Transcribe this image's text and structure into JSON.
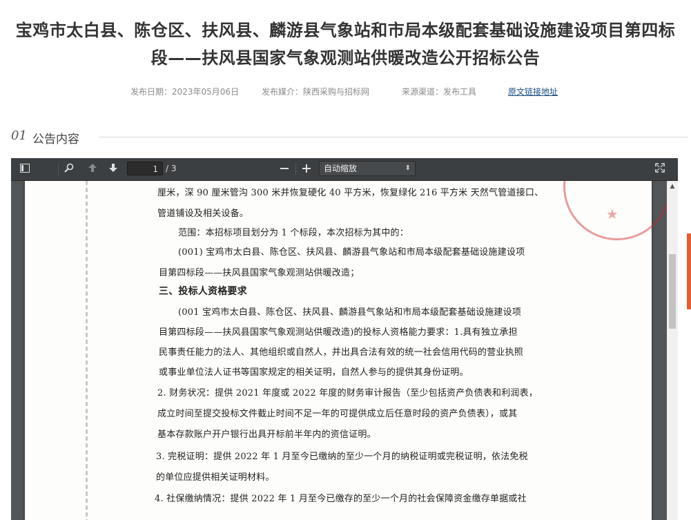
{
  "article": {
    "title_line1": "宝鸡市太白县、陈仓区、扶风县、麟游县气象站和市局本级配套基础设施建设项目第四标",
    "title_line2": "段——扶风县国家气象观测站供暖改造公开招标公告",
    "publish_date": "发布日期：2023年05月06日",
    "publish_media": "发布媒介：陕西采购与招标网",
    "source_channel": "来源渠道：发布工具",
    "original_link": "原文链接地址"
  },
  "section": {
    "number": "01",
    "label": "公告内容"
  },
  "pdf_viewer": {
    "current_page": "1",
    "total_pages": "/ 3",
    "zoom": "自动缩放",
    "icons": {
      "sidebar": "sidebar-toggle-icon",
      "search": "search-icon",
      "prev": "arrow-up-icon",
      "next": "arrow-down-icon",
      "zoom_out": "minus-icon",
      "zoom_in": "plus-icon",
      "fullscreen": "fullscreen-icon"
    }
  },
  "document_lines": [
    "厘米，深 90 厘米管沟 300 米并恢复硬化 40 平方米，恢复绿化 216 平方米 天然气管道接口、",
    "管道铺设及相关设备。",
    "范围：本招标项目划分为 1 个标段，本次招标为其中的：",
    "(001) 宝鸡市太白县、陈仓区、扶风县、麟游县气象站和市局本级配套基础设施建设项",
    "目第四标段——扶风县国家气象观测站供暖改造；",
    "三、投标人资格要求",
    "(001 宝鸡市太白县、陈仓区、扶风县、麟游县气象站和市局本级配套基础设施建设项",
    "目第四标段——扶风县国家气象观测站供暖改造)的投标人资格能力要求：1.具有独立承担",
    "民事责任能力的法人、其他组织或自然人，并出具合法有效的统一社会信用代码的营业执照",
    "或事业单位法人证书等国家规定的相关证明，自然人参与的提供其身份证明。",
    "2. 财务状况：提供 2021 年度或 2022 年度的财务审计报告（至少包括资产负债表和利润表，",
    "成立时间至提交投标文件截止时间不足一年的可提供成立后任意时段的资产负债表），或其",
    "基本存款账户开户银行出具开标前半年内的资信证明。",
    "3. 完税证明：提供 2022 年 1 月至今已缴纳的至少一个月的纳税证明或完税证明，依法免税",
    "的单位应提供相关证明材料。",
    "4. 社保缴纳情况：提供 2022 年 1 月至今已缴存的至少一个月的社会保障资金缴存单据或社"
  ],
  "colors": {
    "accent": "#e35e35",
    "link": "#1d4e89",
    "viewer_bg": "#525659",
    "toolbar_bg": "#3c3f41"
  }
}
